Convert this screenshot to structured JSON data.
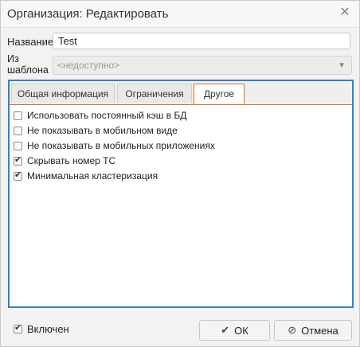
{
  "window": {
    "title": "Организация: Редактировать",
    "close_icon": "close-icon"
  },
  "form": {
    "name_label": "Название",
    "name_value": "Test",
    "template_label": "Из шаблона",
    "template_value": "<недоступно>"
  },
  "tabs": [
    {
      "label": "Общая информация",
      "active": false
    },
    {
      "label": "Ограничения",
      "active": false
    },
    {
      "label": "Другое",
      "active": true
    }
  ],
  "options": [
    {
      "label": "Использовать постоянный кэш в БД",
      "checked": false
    },
    {
      "label": "Не показывать в мобильном виде",
      "checked": false
    },
    {
      "label": "Не показывать в мобильных приложениях",
      "checked": false
    },
    {
      "label": "Скрывать номер ТС",
      "checked": true
    },
    {
      "label": "Минимальная кластеризация",
      "checked": true
    }
  ],
  "footer": {
    "enabled_label": "Включен",
    "enabled_checked": true,
    "ok_label": "ОК",
    "cancel_label": "Отмена"
  },
  "colors": {
    "accent_tab": "#e06b1c",
    "panel_border": "#3a7dbf"
  }
}
